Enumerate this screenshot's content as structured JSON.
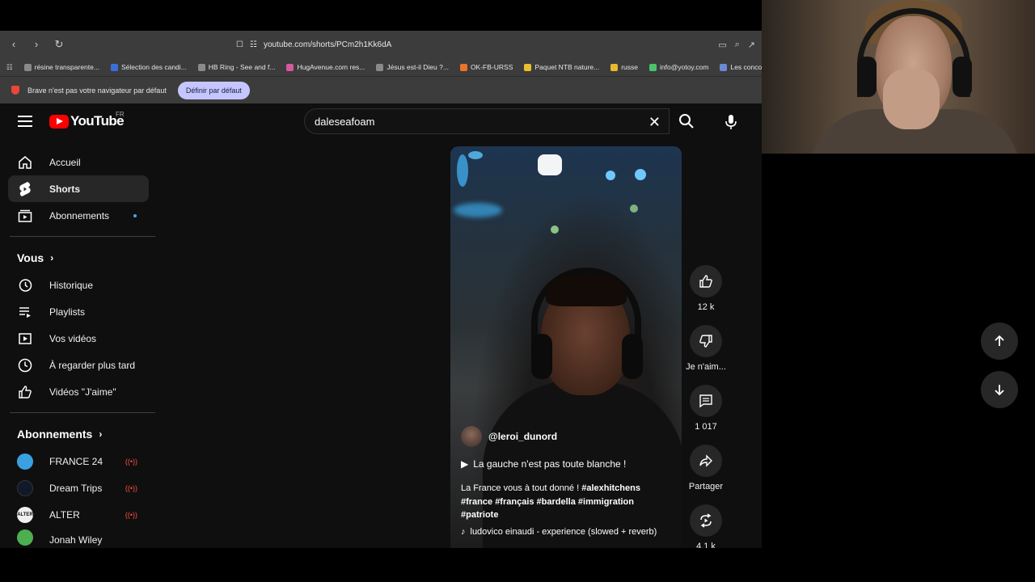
{
  "browser": {
    "url": "youtube.com/shorts/PCm2h1Kk6dA",
    "bookmarks": [
      {
        "label": "résine transparente...",
        "color": "#8a8a8a"
      },
      {
        "label": "Sélection des candi...",
        "color": "#3a6fd8"
      },
      {
        "label": "HB Ring - See and f...",
        "color": "#8a8a8a"
      },
      {
        "label": "HugAvenue.com res...",
        "color": "#d45a9a"
      },
      {
        "label": "Jésus est-il Dieu ?...",
        "color": "#8a8a8a"
      },
      {
        "label": "OK-FB-URSS",
        "color": "#e8742a"
      },
      {
        "label": "Paquet NTB nature...",
        "color": "#e8c02a"
      },
      {
        "label": "russe",
        "color": "#e8b92a"
      },
      {
        "label": "info@yotoy.com",
        "color": "#4ac26a"
      },
      {
        "label": "Les concours d'aute...",
        "color": "#6a8ad8"
      }
    ],
    "infobar_text": "Brave n'est pas votre navigateur par défaut",
    "infobar_button": "Définir par défaut"
  },
  "youtube": {
    "logo_text": "YouTube",
    "logo_region": "FR",
    "search_value": "daleseafoam",
    "sidebar": {
      "main": [
        {
          "label": "Accueil",
          "icon": "home-icon"
        },
        {
          "label": "Shorts",
          "icon": "shorts-icon"
        },
        {
          "label": "Abonnements",
          "icon": "subscriptions-icon"
        }
      ],
      "you_heading": "Vous",
      "you": [
        {
          "label": "Historique",
          "icon": "history-icon"
        },
        {
          "label": "Playlists",
          "icon": "playlists-icon"
        },
        {
          "label": "Vos vidéos",
          "icon": "your-videos-icon"
        },
        {
          "label": "À regarder plus tard",
          "icon": "watch-later-icon"
        },
        {
          "label": "Vidéos \"J'aime\"",
          "icon": "liked-videos-icon"
        }
      ],
      "subs_heading": "Abonnements",
      "subscriptions": [
        {
          "label": "FRANCE 24",
          "avatar_text": "",
          "avatar_color": "#3aa0e0"
        },
        {
          "label": "Dream Trips",
          "avatar_text": "",
          "avatar_color": "#111827"
        },
        {
          "label": "ALTER",
          "avatar_text": "ALTER",
          "avatar_color": "#f0f0f0"
        },
        {
          "label": "Jonah Wiley",
          "avatar_text": "",
          "avatar_color": "#4caf50"
        }
      ]
    },
    "short": {
      "channel": "@leroi_dunord",
      "title": "La gauche n'est pas toute blanche !",
      "desc_plain": "La France vous à tout donné ! ",
      "desc_tags_1": "#alexhitchens",
      "desc_line2": "#france #français #bardella #immigration",
      "desc_line3": "#patriote",
      "music": "ludovico einaudi - experience (slowed + reverb)"
    },
    "actions": {
      "likes": "12 k",
      "dislike": "Je n'aim...",
      "comments": "1 017",
      "share": "Partager",
      "remix": "4,1 k"
    }
  }
}
